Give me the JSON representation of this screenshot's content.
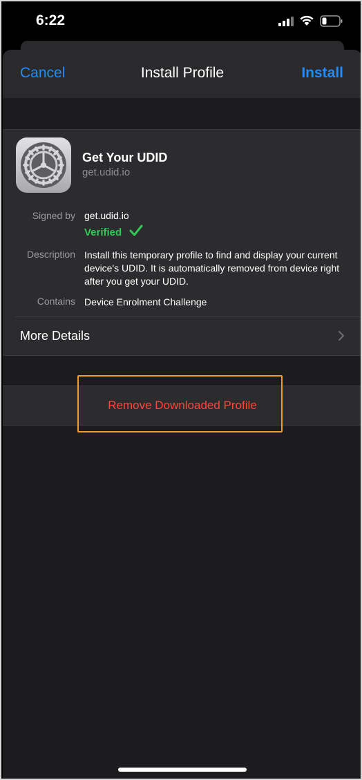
{
  "status": {
    "time": "6:22",
    "signal_icon": "cellular-signal-icon",
    "wifi_icon": "wifi-icon",
    "battery_icon": "battery-icon"
  },
  "nav": {
    "cancel_label": "Cancel",
    "title": "Install Profile",
    "install_label": "Install"
  },
  "profile": {
    "icon": "settings-gear-icon",
    "name": "Get Your UDID",
    "domain": "get.udid.io",
    "signed_by_label": "Signed by",
    "signed_by_value": "get.udid.io",
    "verified_label": "Verified",
    "description_label": "Description",
    "description_value": "Install this temporary profile to find and display your current device's UDID. It is automatically removed from device right after you get your UDID.",
    "contains_label": "Contains",
    "contains_value": "Device Enrolment Challenge",
    "more_details_label": "More Details"
  },
  "actions": {
    "remove_label": "Remove Downloaded Profile"
  },
  "colors": {
    "accent": "#1f8cff",
    "verified": "#34c759",
    "destructive": "#ff453a",
    "highlight": "#f0a020"
  }
}
